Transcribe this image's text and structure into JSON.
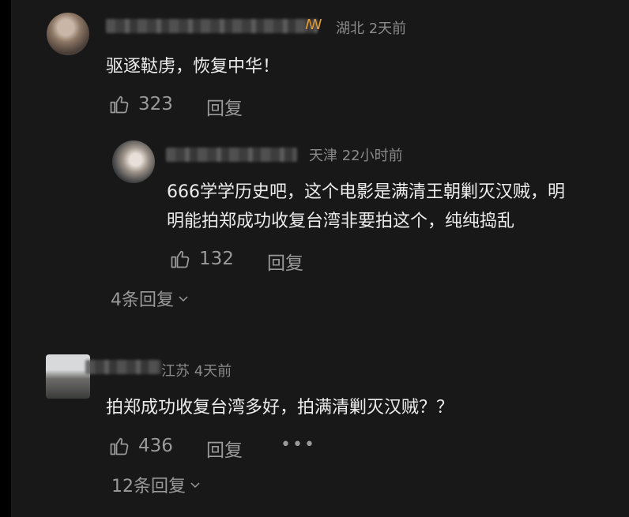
{
  "comments": [
    {
      "location": "湖北",
      "time": "2天前",
      "text": "驱逐鞑虏，恢复中华！",
      "likes": "323",
      "reply_label": "回复",
      "replies": [
        {
          "location": "天津",
          "time": "22小时前",
          "text_line1": "666学学历史吧，这个电影是满清王朝剿灭汉贼，明",
          "text_line2": "明能拍郑成功收复台湾非要拍这个，纯纯捣乱",
          "likes": "132",
          "reply_label": "回复"
        }
      ],
      "expand_label": "4条回复"
    },
    {
      "location_partial": "江苏",
      "time": "4天前",
      "text": "拍郑成功收复台湾多好，拍满清剿灭汉贼？？",
      "likes": "436",
      "reply_label": "回复",
      "expand_label": "12条回复"
    }
  ],
  "colors": {
    "background": "#181818",
    "text": "#ececec",
    "muted": "#8a8a8a",
    "vip_badge": "#e79a2f"
  }
}
